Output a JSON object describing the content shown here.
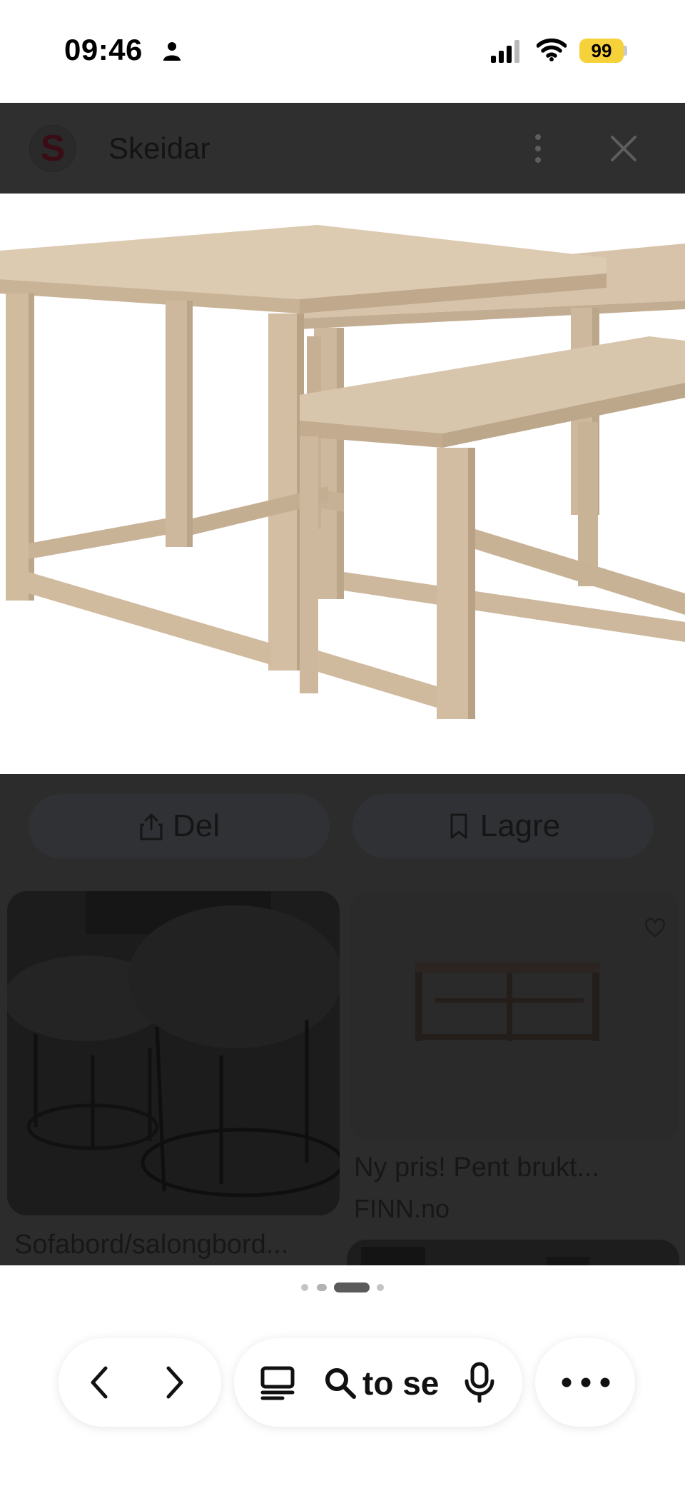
{
  "status_bar": {
    "time": "09:46",
    "battery_level": "99",
    "battery_color": "#f6d23a",
    "icons": [
      "person-icon",
      "signal-icon",
      "wifi-icon",
      "battery-icon"
    ]
  },
  "header": {
    "logo_letter": "S",
    "site_name": "Skeidar",
    "icons": [
      "more-vertical-icon",
      "close-icon"
    ]
  },
  "hero_image": {
    "subject": "nesting tables"
  },
  "actions": {
    "share_label": "Del",
    "save_label": "Lagre"
  },
  "results": [
    {
      "title": "Sofabord/salongbord..."
    },
    {
      "title": "Ny pris! Pent brukt...",
      "source": "FINN.no"
    },
    {
      "title": ""
    }
  ],
  "pagination": {
    "count": 4,
    "active_index": 2
  },
  "toolbar": {
    "search_text": "to se",
    "icons": [
      "back-icon",
      "forward-icon",
      "tabs-icon",
      "search-icon",
      "microphone-icon",
      "more-horizontal-icon"
    ]
  },
  "colors": {
    "header_bg": "#2f2f2f",
    "overlay_bg": "#2c2c2c",
    "wood": "#d9c6ad"
  }
}
